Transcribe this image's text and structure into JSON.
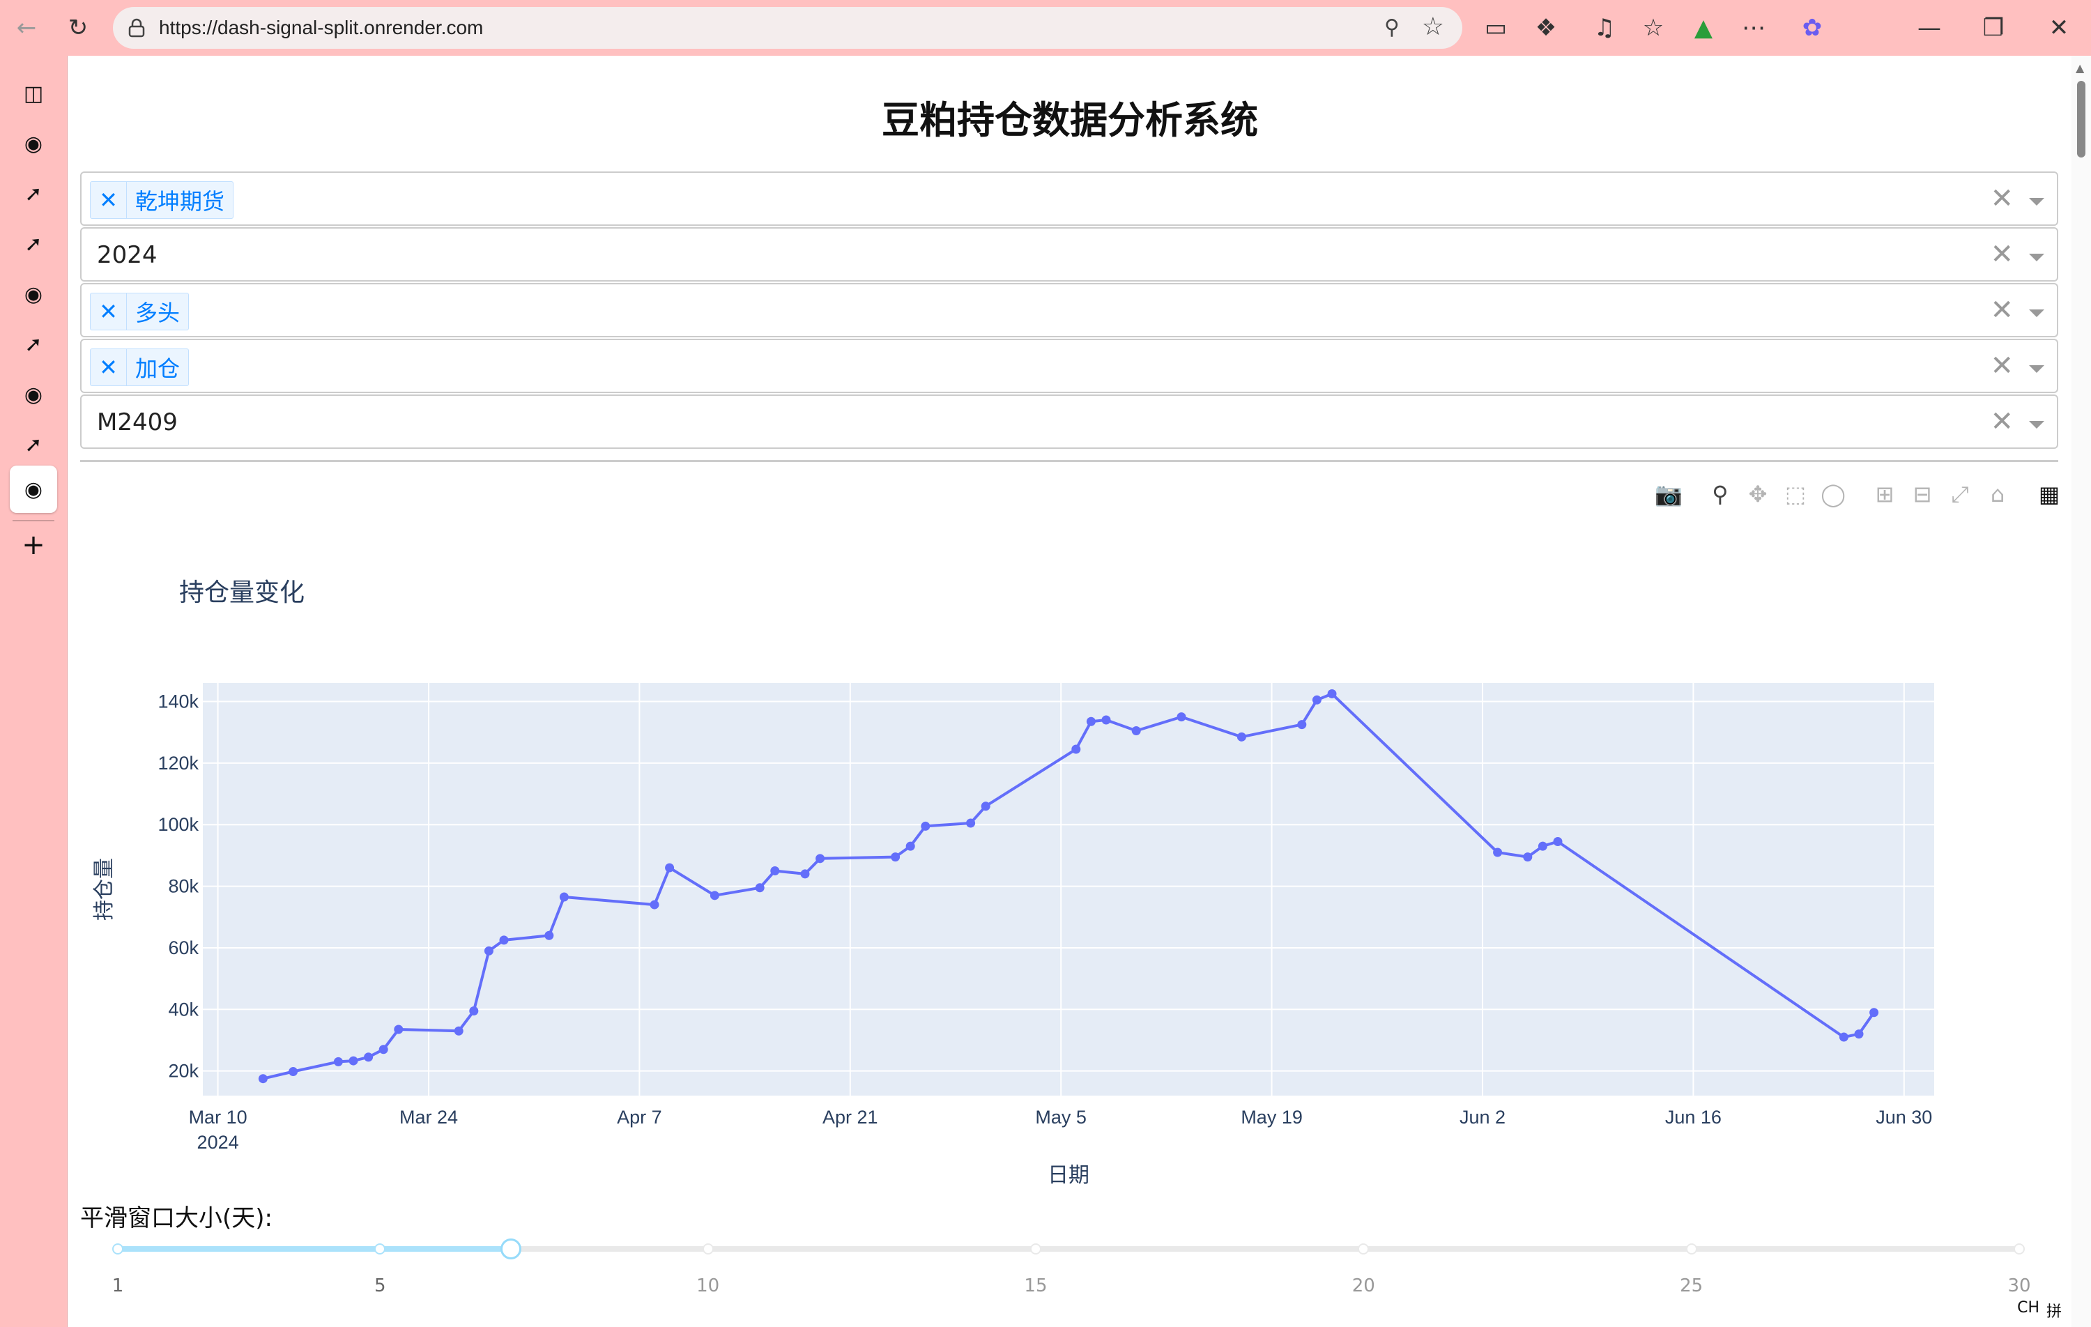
{
  "browser": {
    "url": "https://dash-signal-split.onrender.com"
  },
  "page": {
    "title": "豆粕持仓数据分析系统"
  },
  "filters": [
    {
      "type": "multi",
      "tag": "乾坤期货"
    },
    {
      "type": "single",
      "value": "2024"
    },
    {
      "type": "multi",
      "tag": "多头"
    },
    {
      "type": "multi",
      "tag": "加仓"
    },
    {
      "type": "single",
      "value": "M2409"
    }
  ],
  "modebar": {
    "icons": [
      "camera-icon",
      "zoom-icon",
      "pan-icon",
      "box-select-icon",
      "lasso-icon",
      "zoom-in-icon",
      "zoom-out-icon",
      "autoscale-icon",
      "reset-axes-icon",
      "plotly-logo-icon"
    ]
  },
  "chart_data": {
    "type": "line",
    "title": "持仓量变化",
    "xlabel": "日期",
    "ylabel": "持仓量",
    "ylim": [
      12000,
      146000
    ],
    "xlim": [
      "2024-03-09",
      "2024-07-02"
    ],
    "y_ticks": [
      {
        "v": 20000,
        "label": "20k"
      },
      {
        "v": 40000,
        "label": "40k"
      },
      {
        "v": 60000,
        "label": "60k"
      },
      {
        "v": 80000,
        "label": "80k"
      },
      {
        "v": 100000,
        "label": "100k"
      },
      {
        "v": 120000,
        "label": "120k"
      },
      {
        "v": 140000,
        "label": "140k"
      }
    ],
    "x_ticks": [
      {
        "date": "2024-03-10",
        "label": "Mar 10",
        "sub": "2024"
      },
      {
        "date": "2024-03-24",
        "label": "Mar 24",
        "sub": ""
      },
      {
        "date": "2024-04-07",
        "label": "Apr 7",
        "sub": ""
      },
      {
        "date": "2024-04-21",
        "label": "Apr 21",
        "sub": ""
      },
      {
        "date": "2024-05-05",
        "label": "May 5",
        "sub": ""
      },
      {
        "date": "2024-05-19",
        "label": "May 19",
        "sub": ""
      },
      {
        "date": "2024-06-02",
        "label": "Jun 2",
        "sub": ""
      },
      {
        "date": "2024-06-16",
        "label": "Jun 16",
        "sub": ""
      },
      {
        "date": "2024-06-30",
        "label": "Jun 30",
        "sub": ""
      }
    ],
    "line_color": "#636efa",
    "bg_color": "#e5ecf6",
    "x": [
      "2024-03-13",
      "2024-03-15",
      "2024-03-18",
      "2024-03-19",
      "2024-03-20",
      "2024-03-21",
      "2024-03-22",
      "2024-03-26",
      "2024-03-27",
      "2024-03-28",
      "2024-03-29",
      "2024-04-01",
      "2024-04-02",
      "2024-04-08",
      "2024-04-09",
      "2024-04-12",
      "2024-04-15",
      "2024-04-16",
      "2024-04-18",
      "2024-04-19",
      "2024-04-24",
      "2024-04-25",
      "2024-04-26",
      "2024-04-29",
      "2024-04-30",
      "2024-05-06",
      "2024-05-07",
      "2024-05-08",
      "2024-05-10",
      "2024-05-13",
      "2024-05-17",
      "2024-05-21",
      "2024-05-22",
      "2024-05-23",
      "2024-06-03",
      "2024-06-05",
      "2024-06-06",
      "2024-06-07",
      "2024-06-26",
      "2024-06-27",
      "2024-06-28"
    ],
    "series": [
      {
        "values": [
          17500,
          19800,
          23000,
          23300,
          24500,
          27000,
          33500,
          33000,
          39500,
          59000,
          62500,
          64000,
          76500,
          74000,
          86000,
          77000,
          79500,
          85000,
          84000,
          89000,
          89500,
          93000,
          99500,
          100500,
          106000,
          124500,
          133500,
          134000,
          130500,
          135000,
          128500,
          132500,
          140500,
          142500,
          91000,
          89500,
          93000,
          94500,
          31000,
          32000,
          39000
        ]
      }
    ]
  },
  "slider": {
    "label": "平滑窗口大小(天):",
    "min": 1,
    "max": 30,
    "value": 7,
    "marks": [
      {
        "v": 1,
        "label": "1"
      },
      {
        "v": 5,
        "label": "5"
      },
      {
        "v": 10,
        "label": "10"
      },
      {
        "v": 15,
        "label": "15"
      },
      {
        "v": 20,
        "label": "20"
      },
      {
        "v": 25,
        "label": "25"
      },
      {
        "v": 30,
        "label": "30"
      }
    ]
  },
  "ime": {
    "lang": "CH",
    "mode": "拼"
  }
}
